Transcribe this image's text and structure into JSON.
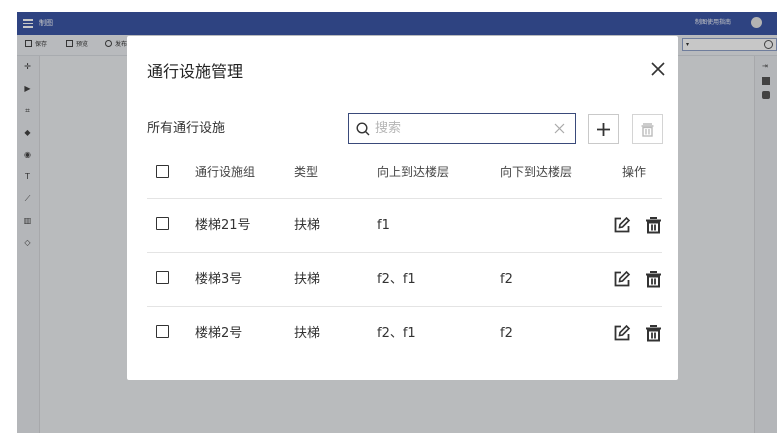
{
  "topbar": {
    "title": "制图",
    "guide": "制图使用指南"
  },
  "toolbar": {
    "save": "保存",
    "preview": "预览",
    "publish": "发布"
  },
  "modal": {
    "title": "通行设施管理",
    "section_label": "所有通行设施",
    "search_placeholder": "搜索",
    "columns": {
      "group": "通行设施组",
      "type": "类型",
      "up": "向上到达楼层",
      "down": "向下到达楼层",
      "ops": "操作"
    },
    "rows": [
      {
        "group": "楼梯21号",
        "type": "扶梯",
        "up": "f1",
        "down": ""
      },
      {
        "group": "楼梯3号",
        "type": "扶梯",
        "up": "f2、f1",
        "down": "f2"
      },
      {
        "group": "楼梯2号",
        "type": "扶梯",
        "up": "f2、f1",
        "down": "f2"
      }
    ]
  },
  "icons": [
    "menu-icon",
    "save-icon",
    "preview-icon",
    "publish-icon",
    "search-icon",
    "close-icon",
    "clear-icon",
    "plus-icon",
    "trash-icon",
    "edit-icon"
  ],
  "colors": {
    "brand": "#3b56a6",
    "overlay": "rgba(0,0,0,0.22)"
  }
}
